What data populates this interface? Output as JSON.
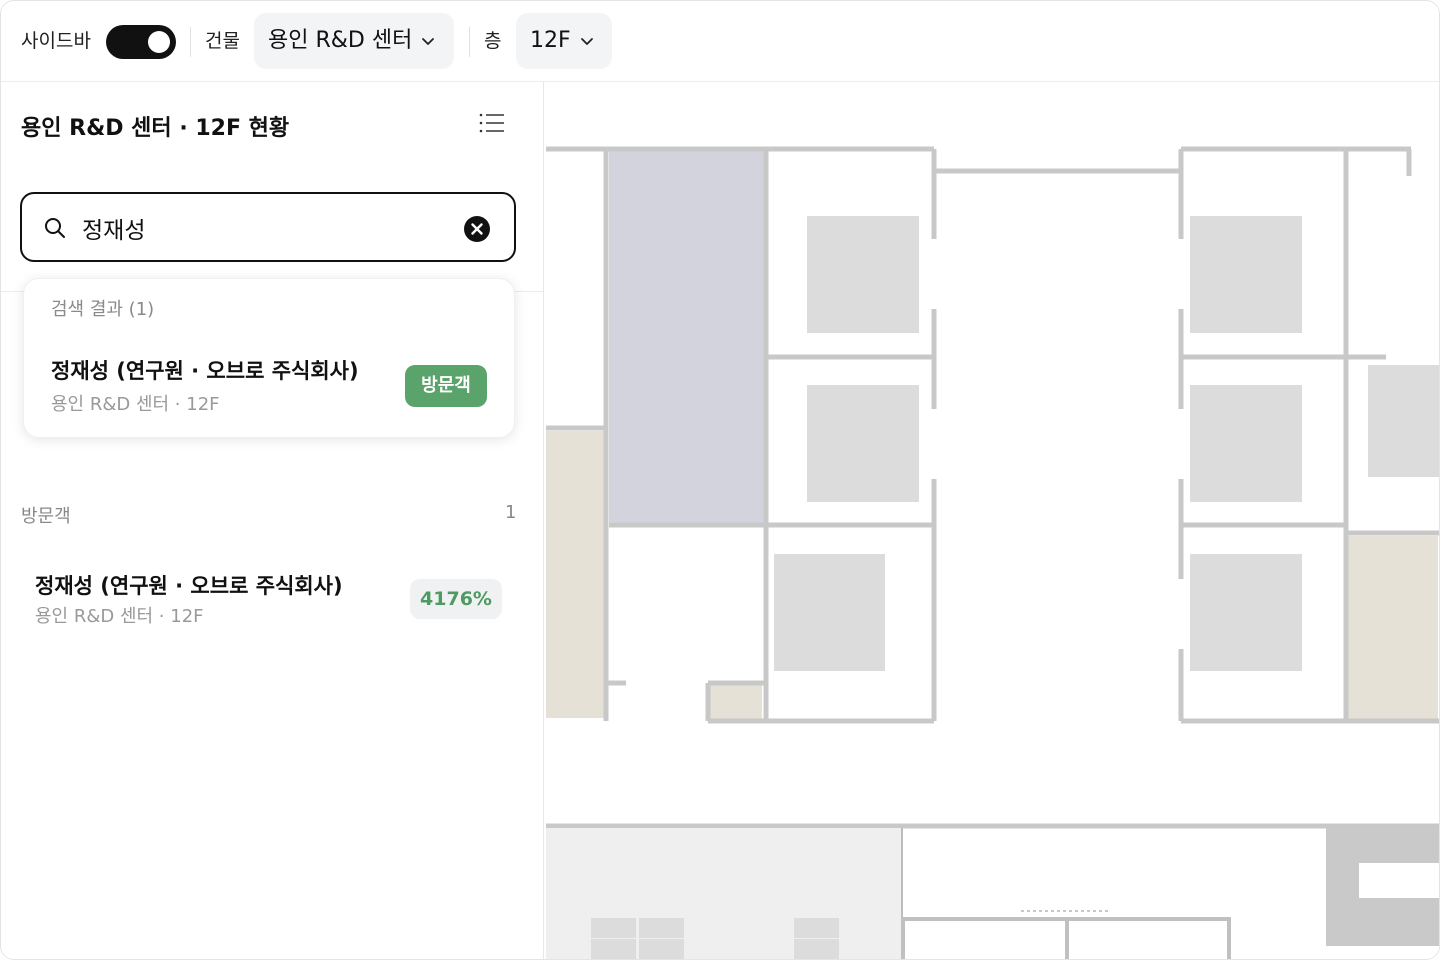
{
  "topbar": {
    "sidebar_label": "사이드바",
    "sidebar_toggle_on": true,
    "building_label": "건물",
    "building_value": "용인 R&D 센터",
    "floor_label": "층",
    "floor_value": "12F"
  },
  "sidebar": {
    "title": "용인 R&D 센터 · 12F 현황",
    "search": {
      "value": "정재성"
    },
    "results": {
      "header": "검색 결과 (1)",
      "items": [
        {
          "name": "정재성 (연구원 · 오브로 주식회사)",
          "location": "용인 R&D 센터 · 12F",
          "badge": "방문객"
        }
      ]
    },
    "section": {
      "title": "방문객",
      "count": "1",
      "items": [
        {
          "name": "정재성 (연구원 · 오브로 주식회사)",
          "location": "용인 R&D 센터 · 12F",
          "value": "4176%"
        }
      ]
    }
  },
  "colors": {
    "accent_green": "#5aa36a",
    "highlight_room": "#d3d3de",
    "beige_room": "#e6e1d7",
    "desk_gray": "#dcdcdc",
    "wall_gray": "#c8c8c8"
  }
}
